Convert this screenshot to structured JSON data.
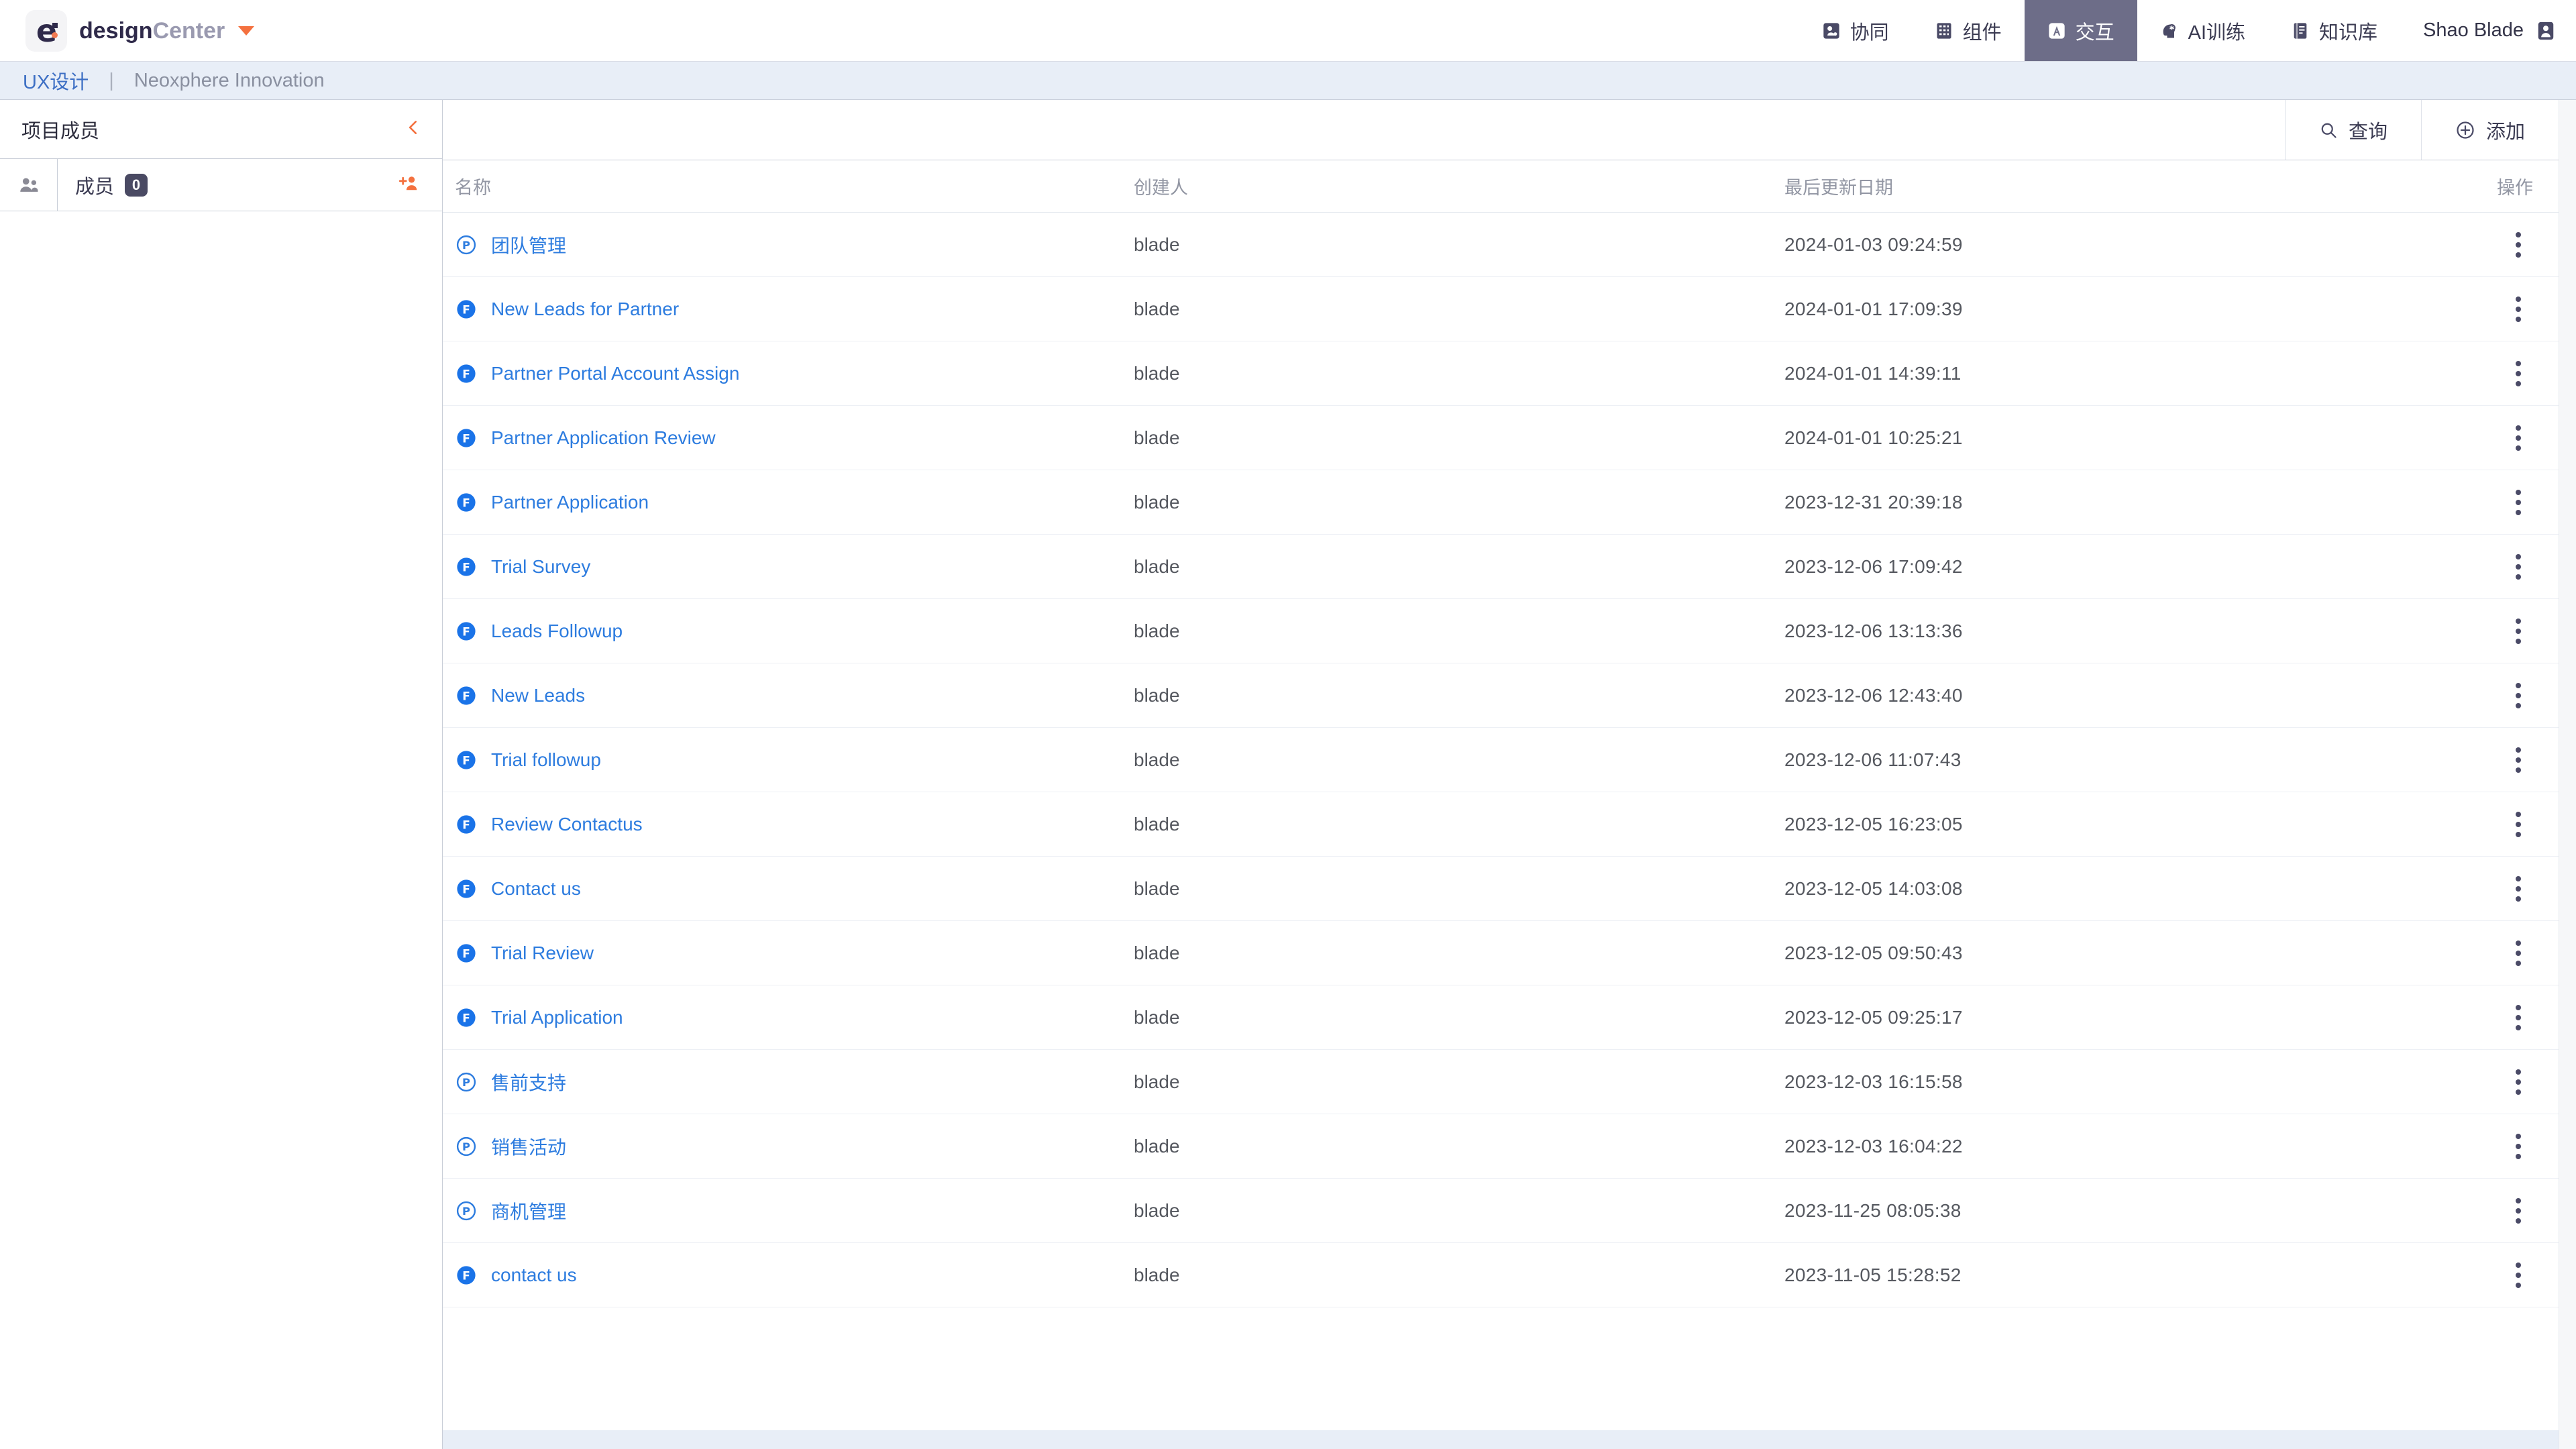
{
  "app": {
    "brand_design": "design",
    "brand_center": "Center",
    "logo_glyph": "e"
  },
  "topnav": {
    "items": [
      {
        "label": "协同",
        "icon": "collaboration-icon",
        "active": false
      },
      {
        "label": "组件",
        "icon": "components-grid-icon",
        "active": false
      },
      {
        "label": "交互",
        "icon": "interaction-icon",
        "active": true
      },
      {
        "label": "AI训练",
        "icon": "ai-brain-icon",
        "active": false
      },
      {
        "label": "知识库",
        "icon": "knowledge-book-icon",
        "active": false
      }
    ],
    "user_name": "Shao Blade",
    "user_icon": "user-avatar-icon"
  },
  "breadcrumb": {
    "link": "UX设计",
    "separator": "|",
    "current": "Neoxphere Innovation"
  },
  "sidebar": {
    "title": "项目成员",
    "collapse_icon": "chevron-left-icon",
    "member_row": {
      "group_icon": "users-icon",
      "label": "成员",
      "count": "0",
      "add_icon": "add-user-icon"
    }
  },
  "toolbar": {
    "search_label": "查询",
    "search_icon": "search-icon",
    "add_label": "添加",
    "add_icon": "plus-circle-icon"
  },
  "table": {
    "columns": {
      "name": "名称",
      "author": "创建人",
      "updated": "最后更新日期",
      "action": "操作"
    },
    "action_icon": "kebab-menu-icon",
    "rows": [
      {
        "icon": "process-outline-icon",
        "type": "P",
        "name": "团队管理",
        "author": "blade",
        "updated": "2024-01-03 09:24:59"
      },
      {
        "icon": "form-filled-icon",
        "type": "F",
        "name": "New Leads for Partner",
        "author": "blade",
        "updated": "2024-01-01 17:09:39"
      },
      {
        "icon": "form-filled-icon",
        "type": "F",
        "name": "Partner Portal Account Assign",
        "author": "blade",
        "updated": "2024-01-01 14:39:11"
      },
      {
        "icon": "form-filled-icon",
        "type": "F",
        "name": "Partner Application Review",
        "author": "blade",
        "updated": "2024-01-01 10:25:21"
      },
      {
        "icon": "form-filled-icon",
        "type": "F",
        "name": "Partner Application",
        "author": "blade",
        "updated": "2023-12-31 20:39:18"
      },
      {
        "icon": "form-filled-icon",
        "type": "F",
        "name": "Trial Survey",
        "author": "blade",
        "updated": "2023-12-06 17:09:42"
      },
      {
        "icon": "form-filled-icon",
        "type": "F",
        "name": "Leads Followup",
        "author": "blade",
        "updated": "2023-12-06 13:13:36"
      },
      {
        "icon": "form-filled-icon",
        "type": "F",
        "name": "New Leads",
        "author": "blade",
        "updated": "2023-12-06 12:43:40"
      },
      {
        "icon": "form-filled-icon",
        "type": "F",
        "name": "Trial followup",
        "author": "blade",
        "updated": "2023-12-06 11:07:43"
      },
      {
        "icon": "form-filled-icon",
        "type": "F",
        "name": "Review Contactus",
        "author": "blade",
        "updated": "2023-12-05 16:23:05"
      },
      {
        "icon": "form-filled-icon",
        "type": "F",
        "name": "Contact us",
        "author": "blade",
        "updated": "2023-12-05 14:03:08"
      },
      {
        "icon": "form-filled-icon",
        "type": "F",
        "name": "Trial Review",
        "author": "blade",
        "updated": "2023-12-05 09:50:43"
      },
      {
        "icon": "form-filled-icon",
        "type": "F",
        "name": "Trial Application",
        "author": "blade",
        "updated": "2023-12-05 09:25:17"
      },
      {
        "icon": "process-outline-icon",
        "type": "P",
        "name": "售前支持",
        "author": "blade",
        "updated": "2023-12-03 16:15:58"
      },
      {
        "icon": "process-outline-icon",
        "type": "P",
        "name": "销售活动",
        "author": "blade",
        "updated": "2023-12-03 16:04:22"
      },
      {
        "icon": "process-outline-icon",
        "type": "P",
        "name": "商机管理",
        "author": "blade",
        "updated": "2023-11-25 08:05:38"
      },
      {
        "icon": "form-filled-icon",
        "type": "F",
        "name": "contact us",
        "author": "blade",
        "updated": "2023-11-05 15:28:52"
      }
    ]
  },
  "colors": {
    "accent_orange": "#f4713f",
    "link_blue": "#2d7cdf",
    "nav_active_bg": "#6d6d88",
    "breadcrumb_bg": "#e8eef7",
    "brand_dark": "#2f2a4a"
  }
}
